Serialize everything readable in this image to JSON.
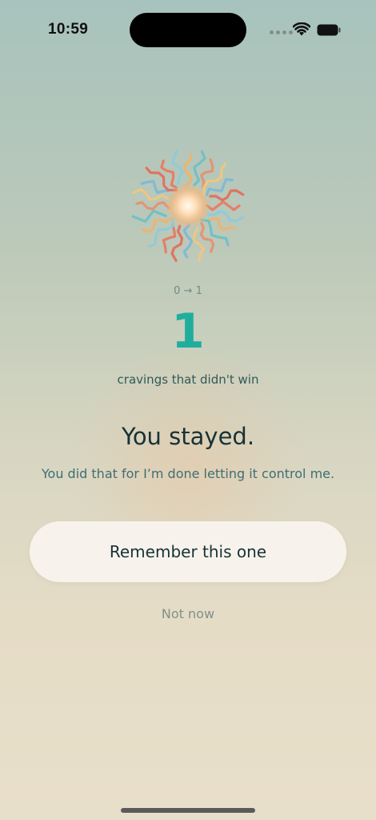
{
  "status_bar": {
    "time": "10:59",
    "icons": [
      "cellular-dots-icon",
      "wifi-icon",
      "battery-icon"
    ]
  },
  "celebration": {
    "icon": "ribbon-burst-icon",
    "progress_label": "0 → 1",
    "count": "1",
    "count_caption": "cravings that didn't win"
  },
  "message": {
    "headline": "You stayed.",
    "subline": "You did that for I’m done letting it control me."
  },
  "actions": {
    "primary_label": "Remember this one",
    "secondary_label": "Not now"
  },
  "colors": {
    "accent": "#1fae9e",
    "text_dark": "#173236",
    "text_muted": "#3f6e72",
    "button_bg": "#f7f3ec"
  }
}
